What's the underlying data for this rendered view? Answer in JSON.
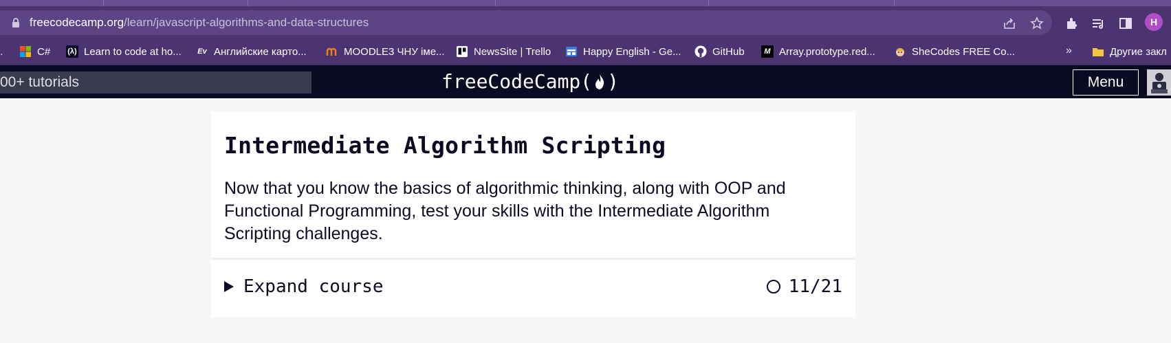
{
  "browser": {
    "url_host": "freecodecamp.org",
    "url_path": "/learn/javascript-algorithms-and-data-structures",
    "profile_initial": "H",
    "bookmarks": [
      {
        "label": "C#",
        "icon": "microsoft-icon"
      },
      {
        "label": "Learn to code at ho...",
        "icon": "freecodecamp-icon"
      },
      {
        "label": "Английские карто...",
        "icon": "ev-icon"
      },
      {
        "label": "MOODLE3 ЧНУ іме...",
        "icon": "moodle-icon"
      },
      {
        "label": "NewsSite | Trello",
        "icon": "trello-icon"
      },
      {
        "label": "Happy English - Ge...",
        "icon": "calendar-icon"
      },
      {
        "label": "GitHub",
        "icon": "github-icon"
      },
      {
        "label": "Array.prototype.red...",
        "icon": "mdn-icon"
      },
      {
        "label": "SheCodes FREE Co...",
        "icon": "shecodes-icon"
      }
    ],
    "other_bookmarks": "Другие закл",
    "overflow": "»"
  },
  "nav": {
    "search_text": "00+ tutorials",
    "logo_prefix": "freeCodeCamp(",
    "logo_suffix": ")",
    "menu_label": "Menu"
  },
  "course": {
    "title": "Intermediate Algorithm Scripting",
    "description": "Now that you know the basics of algorithmic thinking, along with OOP and Functional Programming, test your skills with the Intermediate Algorithm Scripting challenges.",
    "expand_label": "Expand course",
    "progress": "11/21"
  },
  "colors": {
    "fcc_nav": "#0a0a23",
    "chrome_toolbar": "#4c3472",
    "page_bg": "#f5f6f7"
  }
}
